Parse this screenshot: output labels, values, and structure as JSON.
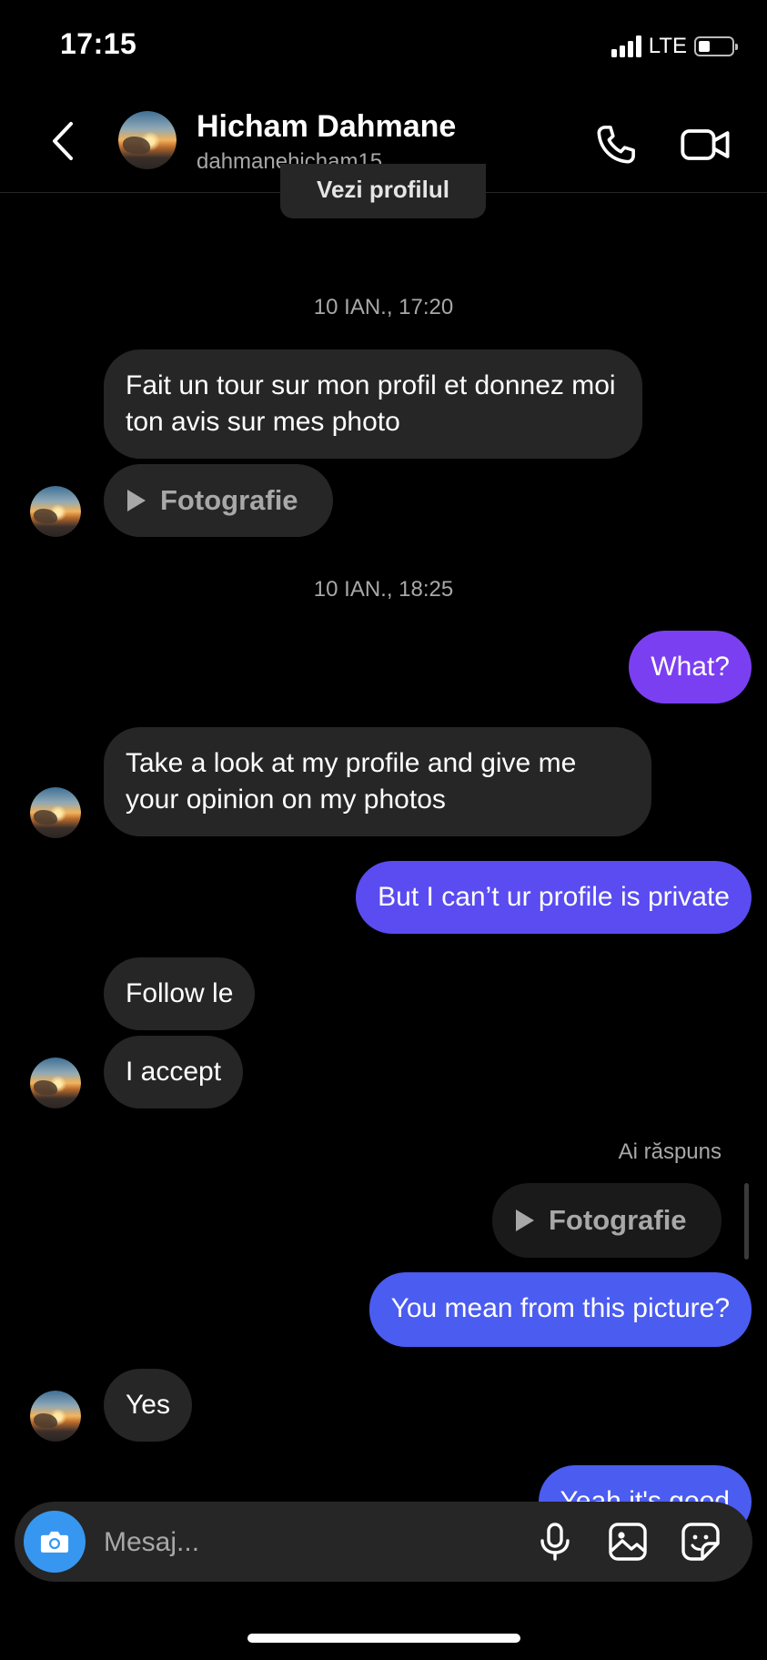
{
  "status_bar": {
    "time": "17:15",
    "network": "LTE",
    "battery_level": 0.3
  },
  "header": {
    "name": "Hicham Dahmane",
    "username": "dahmanehicham15",
    "icons": [
      "back-arrow-icon",
      "phone-icon",
      "video-camera-icon"
    ]
  },
  "chat": {
    "view_profile": "Vezi profilul",
    "timestamp_1": "10 IAN., 17:20",
    "msg_1": "Fait un tour sur mon profil et donnez moi ton avis sur mes photo",
    "media_1": "Fotografie",
    "timestamp_2": "10 IAN., 18:25",
    "msg_what": "What?",
    "msg_take_look": "Take a look at my profile and give me your opinion on my photos",
    "msg_private": "But I can’t ur profile is private",
    "msg_follow": "Follow le",
    "msg_accept": "I accept",
    "replied_label": "Ai răspuns",
    "media_2": "Fotografie",
    "msg_picture": "You mean from this picture?",
    "msg_yes": "Yes",
    "msg_good": "Yeah it's good"
  },
  "composer": {
    "placeholder": "Mesaj...",
    "icons": [
      "camera-icon",
      "microphone-icon",
      "gallery-icon",
      "sticker-icon"
    ]
  },
  "colors": {
    "background": "#000000",
    "incoming_bubble": "#262626",
    "outgoing_purple": "#7b3ff2",
    "outgoing_indigo": "#5a4cf0",
    "outgoing_blue": "#4b5cf0",
    "camera_button": "#3797f0"
  }
}
